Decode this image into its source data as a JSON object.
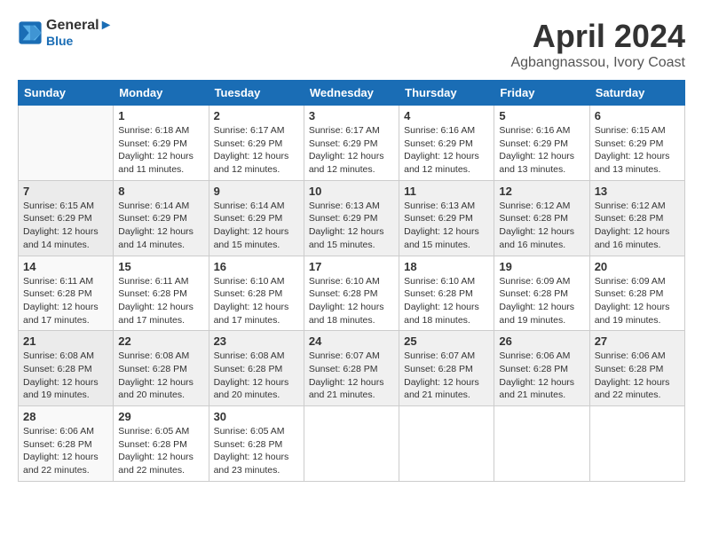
{
  "header": {
    "logo_line1": "General",
    "logo_line2": "Blue",
    "title": "April 2024",
    "subtitle": "Agbangnassou, Ivory Coast"
  },
  "days_of_week": [
    "Sunday",
    "Monday",
    "Tuesday",
    "Wednesday",
    "Thursday",
    "Friday",
    "Saturday"
  ],
  "weeks": [
    [
      {
        "num": "",
        "info": ""
      },
      {
        "num": "1",
        "info": "Sunrise: 6:18 AM\nSunset: 6:29 PM\nDaylight: 12 hours\nand 11 minutes."
      },
      {
        "num": "2",
        "info": "Sunrise: 6:17 AM\nSunset: 6:29 PM\nDaylight: 12 hours\nand 12 minutes."
      },
      {
        "num": "3",
        "info": "Sunrise: 6:17 AM\nSunset: 6:29 PM\nDaylight: 12 hours\nand 12 minutes."
      },
      {
        "num": "4",
        "info": "Sunrise: 6:16 AM\nSunset: 6:29 PM\nDaylight: 12 hours\nand 12 minutes."
      },
      {
        "num": "5",
        "info": "Sunrise: 6:16 AM\nSunset: 6:29 PM\nDaylight: 12 hours\nand 13 minutes."
      },
      {
        "num": "6",
        "info": "Sunrise: 6:15 AM\nSunset: 6:29 PM\nDaylight: 12 hours\nand 13 minutes."
      }
    ],
    [
      {
        "num": "7",
        "info": "Sunrise: 6:15 AM\nSunset: 6:29 PM\nDaylight: 12 hours\nand 14 minutes."
      },
      {
        "num": "8",
        "info": "Sunrise: 6:14 AM\nSunset: 6:29 PM\nDaylight: 12 hours\nand 14 minutes."
      },
      {
        "num": "9",
        "info": "Sunrise: 6:14 AM\nSunset: 6:29 PM\nDaylight: 12 hours\nand 15 minutes."
      },
      {
        "num": "10",
        "info": "Sunrise: 6:13 AM\nSunset: 6:29 PM\nDaylight: 12 hours\nand 15 minutes."
      },
      {
        "num": "11",
        "info": "Sunrise: 6:13 AM\nSunset: 6:29 PM\nDaylight: 12 hours\nand 15 minutes."
      },
      {
        "num": "12",
        "info": "Sunrise: 6:12 AM\nSunset: 6:28 PM\nDaylight: 12 hours\nand 16 minutes."
      },
      {
        "num": "13",
        "info": "Sunrise: 6:12 AM\nSunset: 6:28 PM\nDaylight: 12 hours\nand 16 minutes."
      }
    ],
    [
      {
        "num": "14",
        "info": "Sunrise: 6:11 AM\nSunset: 6:28 PM\nDaylight: 12 hours\nand 17 minutes."
      },
      {
        "num": "15",
        "info": "Sunrise: 6:11 AM\nSunset: 6:28 PM\nDaylight: 12 hours\nand 17 minutes."
      },
      {
        "num": "16",
        "info": "Sunrise: 6:10 AM\nSunset: 6:28 PM\nDaylight: 12 hours\nand 17 minutes."
      },
      {
        "num": "17",
        "info": "Sunrise: 6:10 AM\nSunset: 6:28 PM\nDaylight: 12 hours\nand 18 minutes."
      },
      {
        "num": "18",
        "info": "Sunrise: 6:10 AM\nSunset: 6:28 PM\nDaylight: 12 hours\nand 18 minutes."
      },
      {
        "num": "19",
        "info": "Sunrise: 6:09 AM\nSunset: 6:28 PM\nDaylight: 12 hours\nand 19 minutes."
      },
      {
        "num": "20",
        "info": "Sunrise: 6:09 AM\nSunset: 6:28 PM\nDaylight: 12 hours\nand 19 minutes."
      }
    ],
    [
      {
        "num": "21",
        "info": "Sunrise: 6:08 AM\nSunset: 6:28 PM\nDaylight: 12 hours\nand 19 minutes."
      },
      {
        "num": "22",
        "info": "Sunrise: 6:08 AM\nSunset: 6:28 PM\nDaylight: 12 hours\nand 20 minutes."
      },
      {
        "num": "23",
        "info": "Sunrise: 6:08 AM\nSunset: 6:28 PM\nDaylight: 12 hours\nand 20 minutes."
      },
      {
        "num": "24",
        "info": "Sunrise: 6:07 AM\nSunset: 6:28 PM\nDaylight: 12 hours\nand 21 minutes."
      },
      {
        "num": "25",
        "info": "Sunrise: 6:07 AM\nSunset: 6:28 PM\nDaylight: 12 hours\nand 21 minutes."
      },
      {
        "num": "26",
        "info": "Sunrise: 6:06 AM\nSunset: 6:28 PM\nDaylight: 12 hours\nand 21 minutes."
      },
      {
        "num": "27",
        "info": "Sunrise: 6:06 AM\nSunset: 6:28 PM\nDaylight: 12 hours\nand 22 minutes."
      }
    ],
    [
      {
        "num": "28",
        "info": "Sunrise: 6:06 AM\nSunset: 6:28 PM\nDaylight: 12 hours\nand 22 minutes."
      },
      {
        "num": "29",
        "info": "Sunrise: 6:05 AM\nSunset: 6:28 PM\nDaylight: 12 hours\nand 22 minutes."
      },
      {
        "num": "30",
        "info": "Sunrise: 6:05 AM\nSunset: 6:28 PM\nDaylight: 12 hours\nand 23 minutes."
      },
      {
        "num": "",
        "info": ""
      },
      {
        "num": "",
        "info": ""
      },
      {
        "num": "",
        "info": ""
      },
      {
        "num": "",
        "info": ""
      }
    ]
  ]
}
